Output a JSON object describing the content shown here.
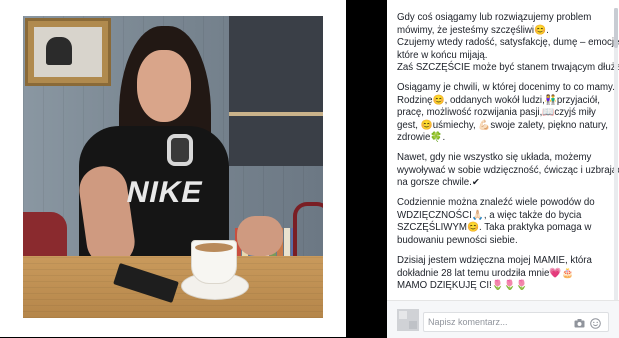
{
  "post": {
    "paragraphs": [
      {
        "lines": [
          "Gdy coś osiągamy lub rozwiązujemy problem",
          "mówimy, że jesteśmy szczęśliwi😊.",
          "Czujemy wtedy radość, satysfakcję, dumę – emocje,",
          "które w końcu mijają.",
          "Zaś SZCZĘŚCIE może być stanem trwającym dłużej."
        ]
      },
      {
        "lines": [
          "Osiągamy je chwili, w której docenimy to co mamy.",
          "Rodzinę😊, oddanych wokół ludzi,👫przyjaciół,",
          "pracę, możliwość rozwijania pasji,📖czyjś miły",
          "gest, 😊uśmiechy, 💪🏻swoje zalety, piękno natury,",
          "zdrowie🍀."
        ]
      },
      {
        "lines": [
          "Nawet, gdy nie wszystko się układa, możemy",
          "wywoływać w sobie wdzięczność, ćwicząc i uzbrajać",
          "na gorsze chwile.✔"
        ]
      },
      {
        "lines": [
          "Codziennie można znaleźć wiele powodów do",
          "WDZIĘCZNOŚCI🙏🏻, a więc także do bycia",
          "SZCZĘŚLIWYM😊. Taka praktyka pomaga w",
          "budowaniu pewności siebie."
        ]
      },
      {
        "lines": [
          "Dzisiaj jestem wdzięczna mojej MAMIE, która",
          "dokładnie 28 lat temu urodziła mnie💗🎂",
          "MAMO DZIĘKUJĘ CI!🌷🌷🌷"
        ]
      }
    ]
  },
  "comment": {
    "placeholder": "Napisz komentarz..."
  },
  "icons": {
    "camera": "camera-icon",
    "emoji": "emoji-icon"
  },
  "colors": {
    "text": "#1d2129",
    "placeholder": "#90949c",
    "background_dark": "#000000"
  }
}
